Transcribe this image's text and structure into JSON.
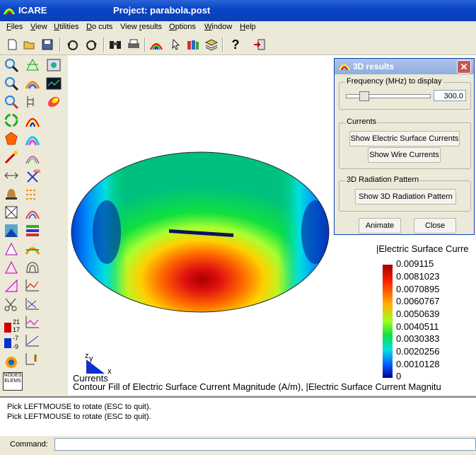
{
  "window": {
    "app_title": "ICARE",
    "project_title": "Project: parabola.post"
  },
  "menu": [
    {
      "label": "Files",
      "u": "F"
    },
    {
      "label": "View",
      "u": "V"
    },
    {
      "label": "Utilities",
      "u": "U"
    },
    {
      "label": "Do cuts",
      "u": "D"
    },
    {
      "label": "View results",
      "u": "r"
    },
    {
      "label": "Options",
      "u": "O"
    },
    {
      "label": "Window",
      "u": "W"
    },
    {
      "label": "Help",
      "u": "H"
    }
  ],
  "menu_labels": {
    "files": "iles",
    "view": "iew",
    "utilities": "tilities",
    "docuts": "o cuts",
    "viewresults_pre": "View ",
    "viewresults_post": "esults",
    "options": "ptions",
    "window": "indow",
    "help": "elp"
  },
  "toolbar_icons": [
    "new-file-icon",
    "open-folder-icon",
    "save-disk-icon",
    "rotate-left-icon",
    "rotate-right-icon",
    "binoculars-icon",
    "printer-icon",
    "rainbow-icon",
    "cursor-pick-icon",
    "books-icon",
    "layers-icon",
    "help-question-icon",
    "exit-icon"
  ],
  "left_tools": {
    "scale_values": [
      "21",
      "17",
      "-7",
      "-9"
    ],
    "nodes_label": [
      "NODES",
      "ELEMS"
    ]
  },
  "dialog": {
    "title": "3D results",
    "frequency_label": "Frequency (MHz) to display",
    "frequency_value": "300.0",
    "slider_fraction": 0.18,
    "currents_group": "Currents",
    "show_surface_currents": "Show Electric Surface Currents",
    "show_wire_currents": "Show Wire Currents",
    "radiation_group": "3D Radiation Pattern",
    "show_radiation": "Show 3D Radiation Pattern",
    "animate": "Animate",
    "close": "Close"
  },
  "plot": {
    "legend_title": "|Electric Surface Curre",
    "legend_values": [
      "0.009115",
      "0.0081023",
      "0.0070895",
      "0.0060767",
      "0.0050639",
      "0.0040511",
      "0.0030383",
      "0.0020256",
      "0.0010128",
      "0"
    ],
    "axis_z": "z",
    "axis_y": "y",
    "axis_x": "x",
    "caption_1": "Currents",
    "caption_2": "Contour Fill of Electric Surface Current Magnitude (A/m), |Electric Surface Current Magnitu"
  },
  "status": {
    "line_1": "Pick LEFTMOUSE to rotate (ESC to quit).",
    "line_2": "Pick LEFTMOUSE to rotate (ESC to quit)."
  },
  "command": {
    "label": "Command:",
    "value": ""
  },
  "colors": {
    "title_blue": "#0a46c8",
    "dialog_close": "#c45a52"
  }
}
